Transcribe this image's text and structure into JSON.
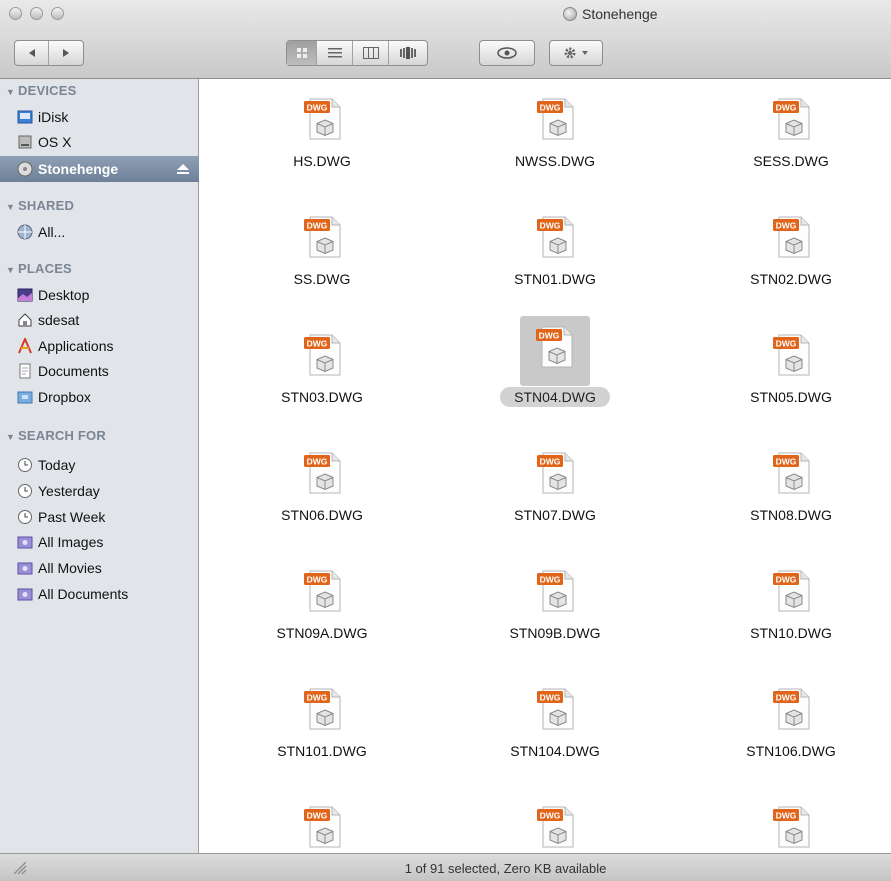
{
  "window": {
    "title": "Stonehenge"
  },
  "toolbar": {
    "back_icon": "back-arrow",
    "forward_icon": "forward-arrow",
    "view_modes": [
      "icon-view",
      "list-view",
      "column-view",
      "cover-flow-view"
    ],
    "active_view": "icon-view",
    "quicklook_icon": "eye",
    "action_icon": "gear"
  },
  "sidebar": {
    "sections": [
      {
        "heading": "DEVICES",
        "items": [
          {
            "label": "iDisk",
            "icon": "idisk-icon"
          },
          {
            "label": "OS X",
            "icon": "hard-drive-icon"
          },
          {
            "label": "Stonehenge",
            "icon": "disk-icon",
            "selected": true
          }
        ]
      },
      {
        "heading": "SHARED",
        "items": [
          {
            "label": "All...",
            "icon": "network-icon"
          }
        ]
      },
      {
        "heading": "PLACES",
        "items": [
          {
            "label": "Desktop",
            "icon": "desktop-icon"
          },
          {
            "label": "sdesat",
            "icon": "home-icon"
          },
          {
            "label": "Applications",
            "icon": "applications-icon"
          },
          {
            "label": "Documents",
            "icon": "documents-icon"
          },
          {
            "label": "Dropbox",
            "icon": "dropbox-icon"
          }
        ]
      },
      {
        "heading": "SEARCH FOR",
        "items": [
          {
            "label": "Today",
            "icon": "clock-icon"
          },
          {
            "label": "Yesterday",
            "icon": "clock-icon"
          },
          {
            "label": "Past Week",
            "icon": "clock-icon"
          },
          {
            "label": "All Images",
            "icon": "smart-folder-icon"
          },
          {
            "label": "All Movies",
            "icon": "smart-folder-icon"
          },
          {
            "label": "All Documents",
            "icon": "smart-folder-icon"
          }
        ]
      }
    ]
  },
  "files": {
    "badge": "DWG",
    "items": [
      "HS.DWG",
      "NWSS.DWG",
      "SESS.DWG",
      "SS.DWG",
      "STN01.DWG",
      "STN02.DWG",
      "STN03.DWG",
      "STN04.DWG",
      "STN05.DWG",
      "STN06.DWG",
      "STN07.DWG",
      "STN08.DWG",
      "STN09A.DWG",
      "STN09B.DWG",
      "STN10.DWG",
      "STN101.DWG",
      "STN104.DWG",
      "STN106.DWG",
      "",
      "",
      ""
    ],
    "selected": "STN04.DWG"
  },
  "status": {
    "text": "1 of 91 selected, Zero KB available"
  }
}
